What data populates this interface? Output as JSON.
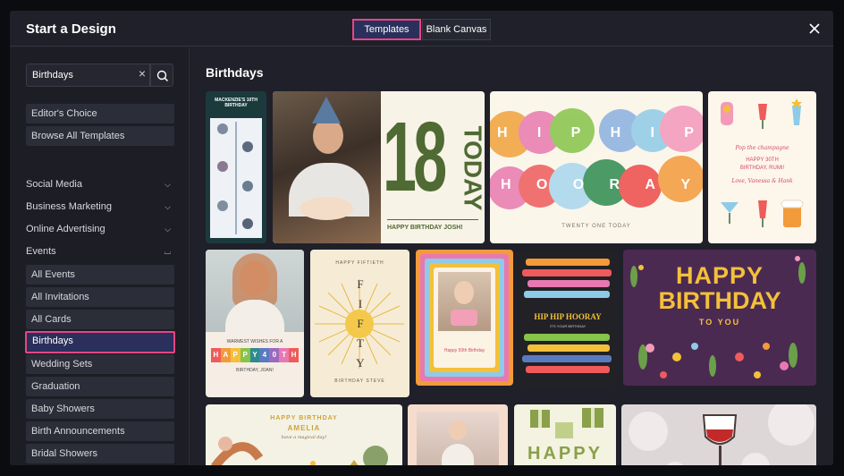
{
  "modal": {
    "title": "Start a Design",
    "tabs": {
      "templates": "Templates",
      "blank": "Blank Canvas"
    }
  },
  "sidebar": {
    "search_value": "Birthdays",
    "editors_choice": "Editor's Choice",
    "browse_all": "Browse All Templates",
    "categories": {
      "social_media": "Social Media",
      "business_marketing": "Business Marketing",
      "online_advertising": "Online Advertising",
      "events": "Events"
    },
    "events_items": {
      "all_events": "All Events",
      "all_invitations": "All Invitations",
      "all_cards": "All Cards",
      "birthdays": "Birthdays",
      "wedding_sets": "Wedding Sets",
      "graduation": "Graduation",
      "baby_showers": "Baby Showers",
      "birth_announcements": "Birth Announcements",
      "bridal_showers": "Bridal Showers"
    }
  },
  "content": {
    "heading": "Birthdays",
    "cards": {
      "mackenzie": {
        "title": "MACKENZIE'S 10TH BIRTHDAY"
      },
      "josh": {
        "number": "18",
        "today": "TODAY",
        "caption": "HAPPY BIRTHDAY JOSH!"
      },
      "hooray": {
        "row1": [
          "H",
          "I",
          "P",
          "H",
          "I",
          "P"
        ],
        "row2": [
          "H",
          "O",
          "O",
          "R",
          "A",
          "Y"
        ],
        "caption": "TWENTY ONE TODAY"
      },
      "rumi": {
        "line1": "Pop the champagne",
        "line2": "HAPPY 30TH",
        "line3": "BIRTHDAY, RUMI!",
        "line4": "Love, Vanessa & Hank"
      },
      "joan": {
        "line1": "WARMEST WISHES FOR A",
        "letters": [
          "H",
          "A",
          "P",
          "P",
          "Y",
          "4",
          "0",
          "T",
          "H"
        ],
        "line2": "BIRTHDAY, JOAN!"
      },
      "fifty": {
        "top": "HAPPY FIFTIETH",
        "letters": [
          "F",
          "I",
          "F",
          "T",
          "Y"
        ],
        "name": "BIRTHDAY STEVE"
      },
      "rainbow": {
        "line1": "Happy 50th Birthday"
      },
      "hiphooray": {
        "title": "HIP HIP HOORAY",
        "sub": "IT'S YOUR BIRTHDAY"
      },
      "happybday": {
        "line1": "HAPPY",
        "line2": "BIRTHDAY",
        "line3": "TO YOU"
      },
      "amelia": {
        "line1": "HAPPY BIRTHDAY",
        "line2": "AMELIA",
        "line3": "have a magical day!"
      },
      "gifts": {
        "word": "HAPPY"
      }
    }
  },
  "colors": {
    "accent": "#e64682",
    "active_bg": "#2a2f5c",
    "modal_bg": "#1f2029"
  }
}
